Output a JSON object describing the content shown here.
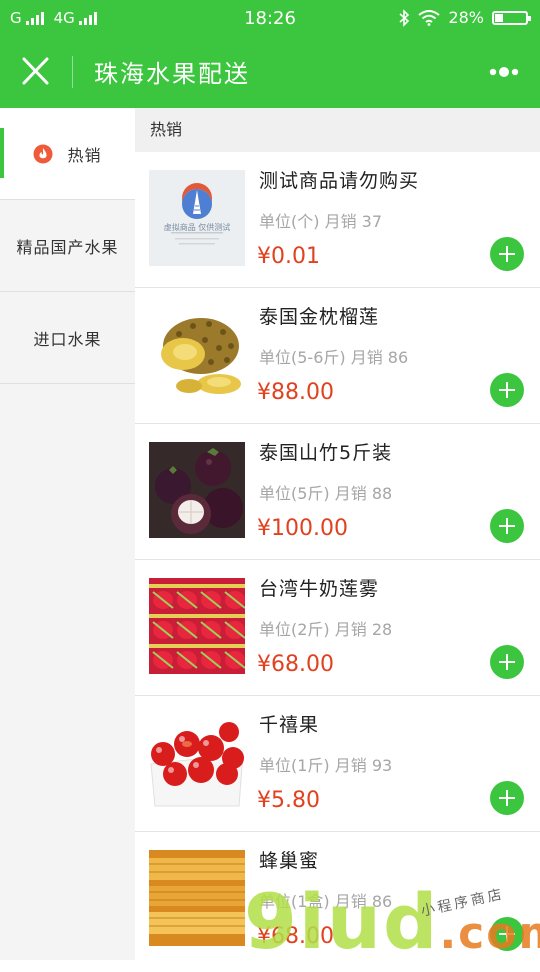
{
  "status_bar": {
    "carrier1": "G",
    "carrier2": "4G",
    "time": "18:26",
    "battery_percent": "28%",
    "battery_level": 0.28
  },
  "header": {
    "title": "珠海水果配送",
    "close_icon": "close-icon",
    "more_icon": "more-dots-icon"
  },
  "sidebar": {
    "items": [
      {
        "label": "热销",
        "icon": "fire-icon",
        "active": true
      },
      {
        "label": "精品国产水果",
        "active": false
      },
      {
        "label": "进口水果",
        "active": false
      }
    ]
  },
  "main": {
    "section_title": "热销",
    "thumb_placeholder": {
      "line1": "虚拟商品 仅供测试"
    },
    "products": [
      {
        "name": "测试商品请勿购买",
        "unit": "单位(个) 月销 37",
        "price": "¥0.01",
        "image": "test-product-thumb"
      },
      {
        "name": "泰国金枕榴莲",
        "unit": "单位(5-6斤) 月销 86",
        "price": "¥88.00",
        "image": "durian-photo"
      },
      {
        "name": "泰国山竹5斤装",
        "unit": "单位(5斤) 月销 88",
        "price": "¥100.00",
        "image": "mangosteen-photo"
      },
      {
        "name": "台湾牛奶莲雾",
        "unit": "单位(2斤) 月销 28",
        "price": "¥68.00",
        "image": "wax-apple-photo"
      },
      {
        "name": "千禧果",
        "unit": "单位(1斤) 月销 93",
        "price": "¥5.80",
        "image": "cherry-tomato-photo"
      },
      {
        "name": "蜂巢蜜",
        "unit": "单位(1盒) 月销 86",
        "price": "¥68.00",
        "image": "honeycomb-photo"
      }
    ]
  },
  "watermark": {
    "brand": "9iud",
    "suffix": ".com",
    "tagline": "小程序商店"
  },
  "colors": {
    "brand_green": "#3cc53e",
    "price_red": "#e0421f"
  }
}
